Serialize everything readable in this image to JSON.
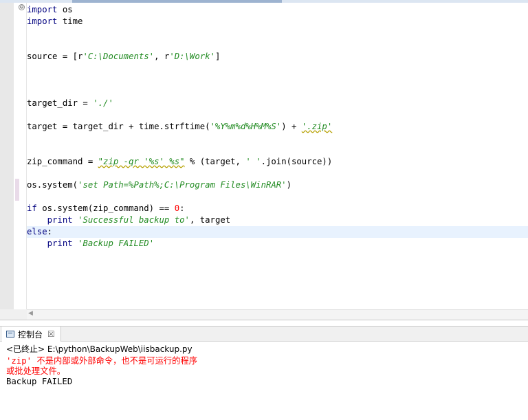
{
  "editor": {
    "lines": [
      [
        {
          "t": "import",
          "c": "kw"
        },
        {
          "t": " os"
        }
      ],
      [
        {
          "t": "import",
          "c": "kw"
        },
        {
          "t": " time"
        }
      ],
      [],
      [],
      [
        {
          "t": "source = [r"
        },
        {
          "t": "'C:\\Documents'",
          "c": "str"
        },
        {
          "t": ", r"
        },
        {
          "t": "'D:\\Work'",
          "c": "str"
        },
        {
          "t": "]"
        }
      ],
      [],
      [],
      [],
      [
        {
          "t": "target_dir = "
        },
        {
          "t": "'./'",
          "c": "str"
        }
      ],
      [],
      [
        {
          "t": "target = target_dir + time.strftime("
        },
        {
          "t": "'%Y%m%d%H%M%S'",
          "c": "str"
        },
        {
          "t": ") + "
        },
        {
          "t": "'.zip'",
          "c": "str"
        }
      ],
      [],
      [],
      [
        {
          "t": "zip_command = "
        },
        {
          "t": "\"zip -qr '%s' %s\"",
          "c": "str"
        },
        {
          "t": " % (target, "
        },
        {
          "t": "' '",
          "c": "str"
        },
        {
          "t": ".join(source))"
        }
      ],
      [],
      [
        {
          "t": "os.system("
        },
        {
          "t": "'set Path=%Path%;C:\\Program Files\\WinRAR'",
          "c": "str"
        },
        {
          "t": ")"
        }
      ],
      [],
      [
        {
          "t": "if",
          "c": "kw"
        },
        {
          "t": " os.system(zip_command) == "
        },
        {
          "t": "0",
          "c": "num"
        },
        {
          "t": ":"
        }
      ],
      [
        {
          "t": "    "
        },
        {
          "t": "print",
          "c": "kw"
        },
        {
          "t": " "
        },
        {
          "t": "'Successful backup to'",
          "c": "str"
        },
        {
          "t": ", target"
        }
      ],
      [
        {
          "t": "else",
          "c": "kw"
        },
        {
          "t": ":"
        }
      ],
      [
        {
          "t": "    "
        },
        {
          "t": "print",
          "c": "kw"
        },
        {
          "t": " "
        },
        {
          "t": "'Backup FAILED'",
          "c": "str"
        }
      ]
    ],
    "current_line_index": 19,
    "fold_glyph": "⊖"
  },
  "console": {
    "tab_label": "控制台",
    "close_glyph": "☒",
    "status": "<已终止> E:\\python\\BackupWeb\\iisbackup.py",
    "output": [
      {
        "text": "'zip' 不是内部或外部命令，也不是可运行的程序",
        "kind": "err"
      },
      {
        "text": "或批处理文件。",
        "kind": "err"
      },
      {
        "text": "Backup FAILED",
        "kind": "out"
      }
    ]
  },
  "colors": {
    "keyword": "#00007f",
    "string": "#228b22",
    "number": "#ff0000",
    "error_text": "#ff0000",
    "current_line": "#e8f2fe"
  }
}
